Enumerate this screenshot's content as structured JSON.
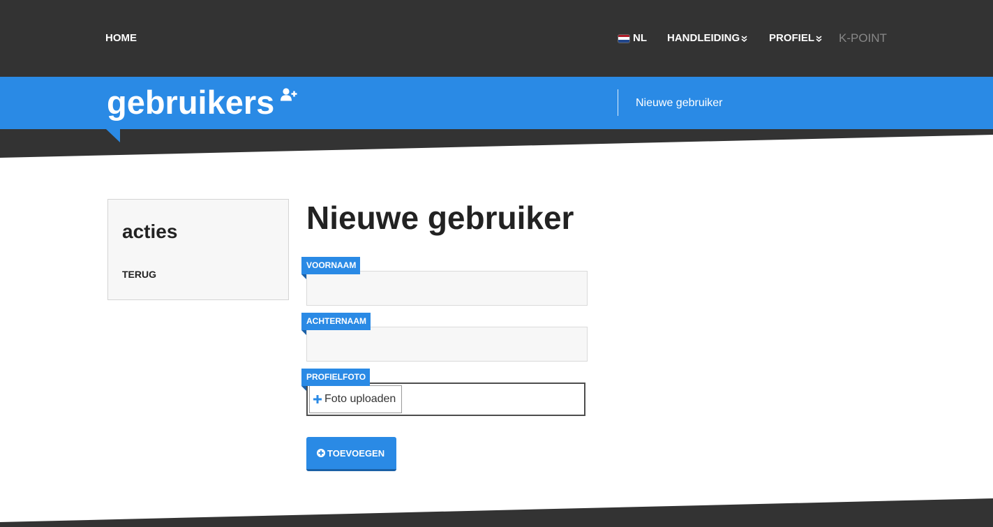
{
  "nav": {
    "home_label": "HOME",
    "language": {
      "label": "NL",
      "flag_icon": "netherlands-flag-icon"
    },
    "items": [
      {
        "label": "HANDLEIDING",
        "icon": "double-chevron-down-icon"
      },
      {
        "label": "PROFIEL",
        "icon": "double-chevron-down-icon"
      }
    ],
    "brand": "K-POINT"
  },
  "banner": {
    "title": "gebruikers",
    "title_icon": "user-plus-icon",
    "breadcrumb": "Nieuwe gebruiker"
  },
  "sidebar": {
    "heading": "acties",
    "links": [
      {
        "label": "TERUG"
      }
    ]
  },
  "form": {
    "title": "Nieuwe gebruiker",
    "fields": [
      {
        "label": "VOORNAAM",
        "value": ""
      },
      {
        "label": "ACHTERNAAM",
        "value": ""
      }
    ],
    "photo": {
      "label": "PROFIELFOTO",
      "button_label": "Foto uploaden",
      "icon": "plus-icon"
    },
    "submit": {
      "label": "TOEVOEGEN",
      "icon": "circle-plus-icon"
    }
  },
  "colors": {
    "dark": "#333333",
    "accent": "#2a8ae5",
    "accent_dark": "#1b60a6",
    "muted": "#888888"
  }
}
